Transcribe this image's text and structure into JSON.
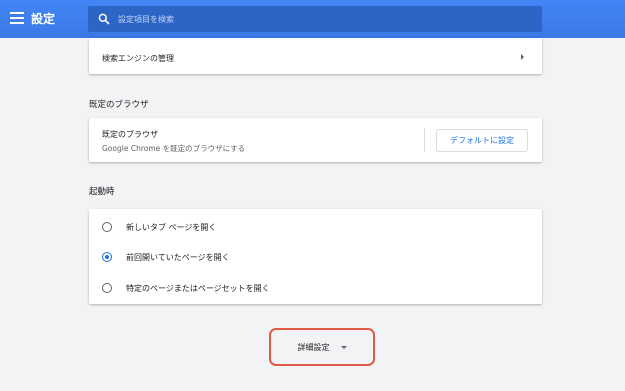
{
  "header": {
    "title": "設定",
    "search_placeholder": "設定項目を検索"
  },
  "search_engine": {
    "manage_label": "検索エンジンの管理"
  },
  "default_browser": {
    "section_title": "既定のブラウザ",
    "row_title": "既定のブラウザ",
    "row_subtitle": "Google Chrome を既定のブラウザにする",
    "button_label": "デフォルトに設定"
  },
  "startup": {
    "section_title": "起動時",
    "options": [
      {
        "label": "新しいタブ ページを開く",
        "checked": false
      },
      {
        "label": "前回開いていたページを開く",
        "checked": true
      },
      {
        "label": "特定のページまたはページセットを開く",
        "checked": false
      }
    ]
  },
  "advanced": {
    "label": "詳細設定"
  },
  "colors": {
    "header_blue": "#3b78e7",
    "accent_blue": "#1a73e8",
    "highlight_red": "#e05a47"
  }
}
